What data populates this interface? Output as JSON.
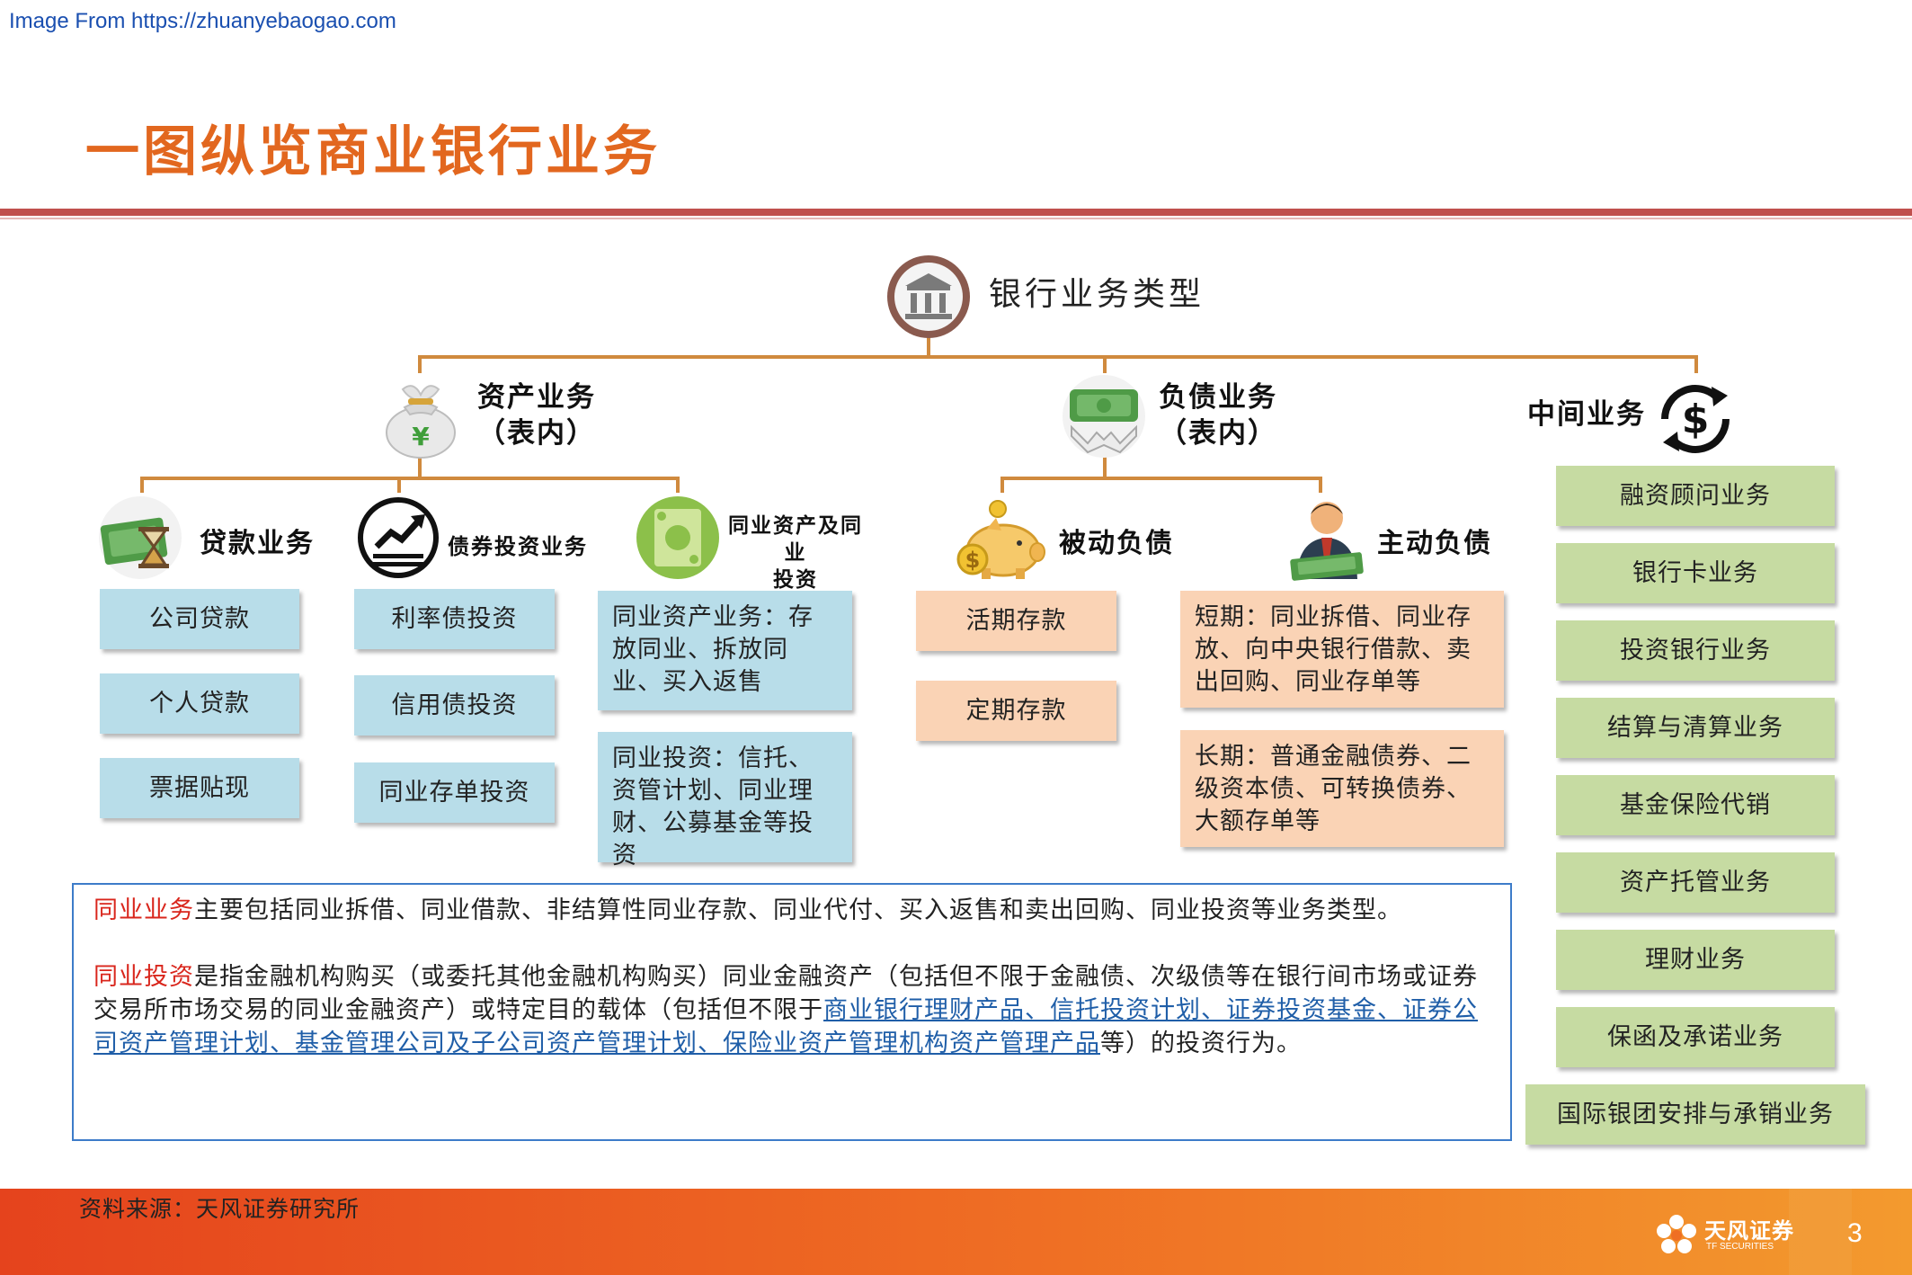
{
  "header": {
    "source_link": "Image From https://zhuanyebaogao.com",
    "title": "一图纵览商业银行业务"
  },
  "diagram": {
    "root": "银行业务类型",
    "assets": {
      "title_line1": "资产业务",
      "title_line2": "（表内）",
      "loans": {
        "title": "贷款业务",
        "items": [
          "公司贷款",
          "个人贷款",
          "票据贴现"
        ]
      },
      "bonds": {
        "title": "债券投资业务",
        "items": [
          "利率债投资",
          "信用债投资",
          "同业存单投资"
        ]
      },
      "interbank": {
        "title_line1": "同业资产及同业",
        "title_line2": "投资",
        "items": [
          "同业资产业务：存放同业、拆放同业、买入返售",
          "同业投资：信托、资管计划、同业理财、公募基金等投资"
        ]
      }
    },
    "liabilities": {
      "title_line1": "负债业务",
      "title_line2": "（表内）",
      "passive": {
        "title": "被动负债",
        "items": [
          "活期存款",
          "定期存款"
        ]
      },
      "active": {
        "title": "主动负债",
        "items": [
          "短期：同业拆借、同业存放、向中央银行借款、卖出回购、同业存单等",
          "长期：普通金融债券、二级资本债、可转换债券、大额存单等"
        ]
      }
    },
    "intermediate": {
      "title": "中间业务",
      "items": [
        "融资顾问业务",
        "银行卡业务",
        "投资银行业务",
        "结算与清算业务",
        "基金保险代销",
        "资产托管业务",
        "理财业务",
        "保函及承诺业务",
        "国际银团安排与承销业务"
      ]
    }
  },
  "note": {
    "p1_term": "同业业务",
    "p1_text": "主要包括同业拆借、同业借款、非结算性同业存款、同业代付、买入返售和卖出回购、同业投资等业务类型。",
    "p2_term": "同业投资",
    "p2_text": "是指金融机构购买（或委托其他金融机构购买）同业金融资产（包括但不限于金融债、次级债等在银行间市场或证券交易所市场交易的同业金融资产）或特定目的载体（包括但不限于",
    "p2_link": "商业银行理财产品、信托投资计划、证券投资基金、证券公司资产管理计划、基金管理公司及子公司资产管理计划、保险业资产管理机构资产管理产品",
    "p2_tail": "等）的投资行为。"
  },
  "footer": {
    "source": "资料来源：天风证券研究所",
    "brand_cn": "天风证券",
    "brand_en": "TF SECURITIES",
    "page_number": "3"
  },
  "colors": {
    "title": "#e2671f",
    "rule": "#c0504d",
    "connector": "#d08a3e",
    "asset_box": "#b8dde9",
    "liability_box": "#fad3b5",
    "intermediate_box": "#c6dba2",
    "highlight": "#d9261c",
    "link": "#1f5ea8"
  }
}
